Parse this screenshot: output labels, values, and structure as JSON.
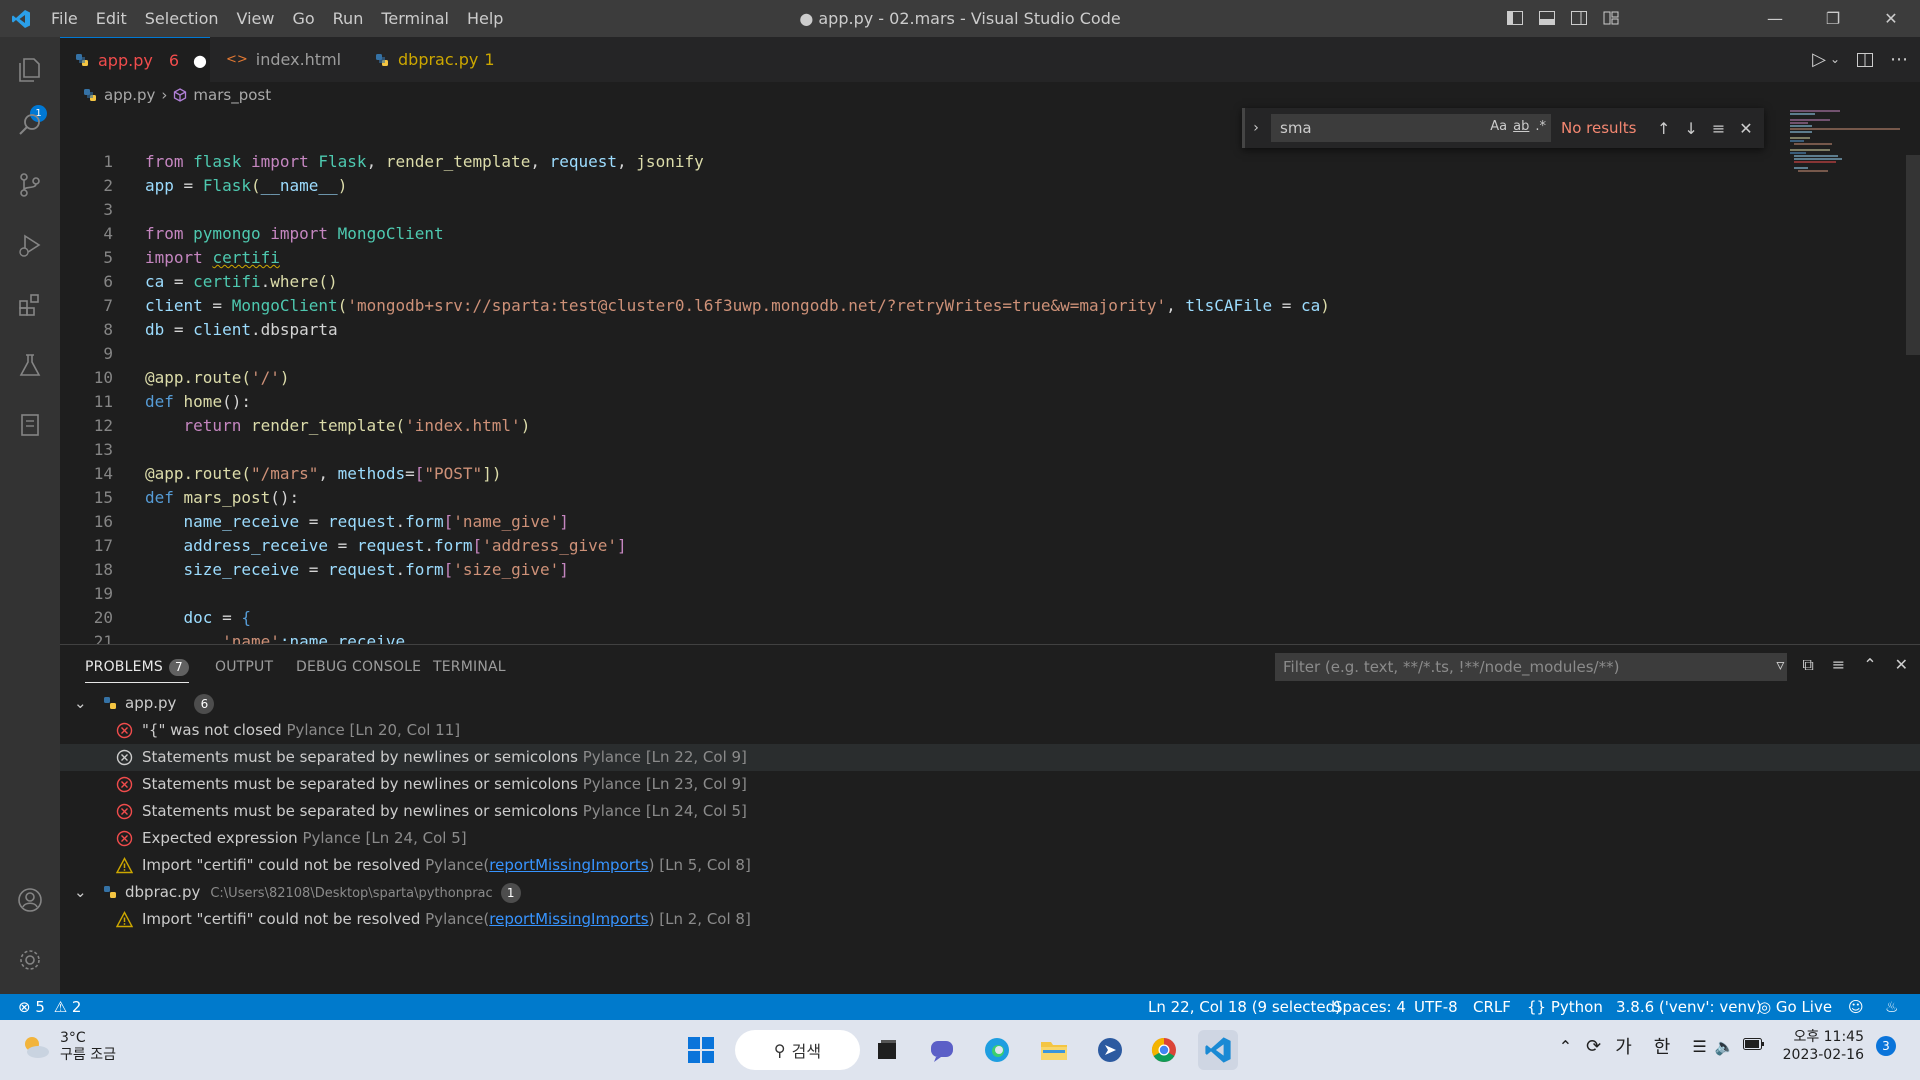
{
  "titlebar": {
    "title": "● app.py - 02.mars - Visual Studio Code",
    "menu": [
      "File",
      "Edit",
      "Selection",
      "View",
      "Go",
      "Run",
      "Terminal",
      "Help"
    ]
  },
  "activity": {
    "explorer_badge": "1"
  },
  "tabs": [
    {
      "label": "app.py",
      "problems": "6",
      "modified": true,
      "active": true
    },
    {
      "label": "index.html",
      "icon": "<>"
    },
    {
      "label": "dbprac.py",
      "problems": "1"
    }
  ],
  "breadcrumb": {
    "file": "app.py",
    "symbol": "mars_post"
  },
  "find": {
    "query": "sma",
    "status": "No results",
    "opt_case": "Aa",
    "opt_word": "ab",
    "opt_regex": ".*"
  },
  "editor": {
    "line_numbers": [
      "1",
      "2",
      "3",
      "4",
      "5",
      "6",
      "7",
      "8",
      "9",
      "10",
      "11",
      "12",
      "13",
      "14",
      "15",
      "16",
      "17",
      "18",
      "19",
      "20",
      "21"
    ],
    "lines": {
      "l1": {
        "a": "from",
        "b": " flask ",
        "c": "import",
        "d": " Flask",
        "e": ", ",
        "f": "render_template",
        "g": ", ",
        "h": "request",
        "i": ", ",
        "j": "jsonify"
      },
      "l2": {
        "a": "app",
        "b": " = ",
        "c": "Flask",
        "d": "(",
        "e": "__name__",
        "f": ")"
      },
      "l4": {
        "a": "from",
        "b": " pymongo ",
        "c": "import",
        "d": " MongoClient"
      },
      "l5": {
        "a": "import",
        "b": "certifi"
      },
      "l6": {
        "a": "ca",
        "b": " = ",
        "c": "certifi",
        "d": ".",
        "e": "where",
        "f": "()"
      },
      "l7": {
        "a": "client",
        "b": " = ",
        "c": "MongoClient",
        "d": "(",
        "e": "'mongodb+srv://sparta:test@cluster0.l6f3uwp.mongodb.net/?retryWrites=true&w=majority'",
        "f": ", ",
        "g": "tlsCAFile",
        "h": " = ",
        "i": "ca",
        "j": ")"
      },
      "l8": {
        "a": "db",
        "b": " = ",
        "c": "client",
        "d": ".dbsparta"
      },
      "l10": {
        "a": "@app.route",
        "b": "(",
        "c": "'/'",
        "d": ")"
      },
      "l11": {
        "a": "def",
        "b": " home",
        "c": "():"
      },
      "l12": {
        "a": "return",
        "b": " render_template",
        "c": "(",
        "d": "'index.html'",
        "e": ")"
      },
      "l14": {
        "a": "@app.route",
        "b": "(",
        "c": "\"/mars\"",
        "d": ", ",
        "e": "methods",
        "f": "=",
        "g": "[",
        "h": "\"POST\"",
        "i": "])"
      },
      "l15": {
        "a": "def",
        "b": " mars_post",
        "c": "():"
      },
      "l16": {
        "a": "name_receive",
        "b": " = ",
        "c": "request",
        "d": ".",
        "e": "form",
        "f": "[",
        "g": "'name_give'",
        "h": "]"
      },
      "l17": {
        "a": "address_receive",
        "b": " = ",
        "c": "request",
        "d": ".",
        "e": "form",
        "f": "[",
        "g": "'address_give'",
        "h": "]"
      },
      "l18": {
        "a": "size_receive",
        "b": " = ",
        "c": "request",
        "d": ".",
        "e": "form",
        "f": "[",
        "g": "'size_give'",
        "h": "]"
      },
      "l20": {
        "a": "doc",
        "b": " = ",
        "c": "{"
      },
      "l21": {
        "a": "'name'",
        "b": ":name_receive"
      }
    }
  },
  "panel": {
    "tabs": [
      "PROBLEMS",
      "OUTPUT",
      "DEBUG CONSOLE",
      "TERMINAL"
    ],
    "problems_count": "7",
    "filter_placeholder": "Filter (e.g. text, **/*.ts, !**/node_modules/**)",
    "groups": [
      {
        "file": "app.py",
        "path": "",
        "count": "6"
      },
      {
        "file": "dbprac.py",
        "path": "C:\\Users\\82108\\Desktop\\sparta\\pythonprac",
        "count": "1"
      }
    ],
    "problems": [
      {
        "msg": "\"{\" was not closed",
        "source": "Pylance",
        "code": "",
        "loc": "[Ln 20, Col 11]"
      },
      {
        "msg": "Statements must be separated by newlines or semicolons",
        "source": "Pylance",
        "code": "",
        "loc": "[Ln 22, Col 9]"
      },
      {
        "msg": "Statements must be separated by newlines or semicolons",
        "source": "Pylance",
        "code": "",
        "loc": "[Ln 23, Col 9]"
      },
      {
        "msg": "Statements must be separated by newlines or semicolons",
        "source": "Pylance",
        "code": "",
        "loc": "[Ln 24, Col 5]"
      },
      {
        "msg": "Expected expression",
        "source": "Pylance",
        "code": "",
        "loc": "[Ln 24, Col 5]"
      },
      {
        "msg": "Import \"certifi\" could not be resolved",
        "source": "Pylance",
        "code": "reportMissingImports",
        "loc": "[Ln 5, Col 8]"
      },
      {
        "msg": "Import \"certifi\" could not be resolved",
        "source": "Pylance",
        "code": "reportMissingImports",
        "loc": "[Ln 2, Col 8]"
      }
    ]
  },
  "statusbar": {
    "errors": "5",
    "warnings": "2",
    "position": "Ln 22, Col 18 (9 selected)",
    "spaces": "Spaces: 4",
    "encoding": "UTF-8",
    "eol": "CRLF",
    "language": "Python",
    "interpreter": "3.8.6 ('venv': venv)",
    "golive": "Go Live"
  },
  "taskbar": {
    "temp": "3°C",
    "weather": "구름 조금",
    "search": "검색",
    "ime1": "가",
    "ime2": "한",
    "time": "오후 11:45",
    "date": "2023-02-16",
    "notif": "3"
  },
  "colors": {
    "accent": "#007acc",
    "error": "#f14c4c",
    "warning": "#cca700"
  }
}
